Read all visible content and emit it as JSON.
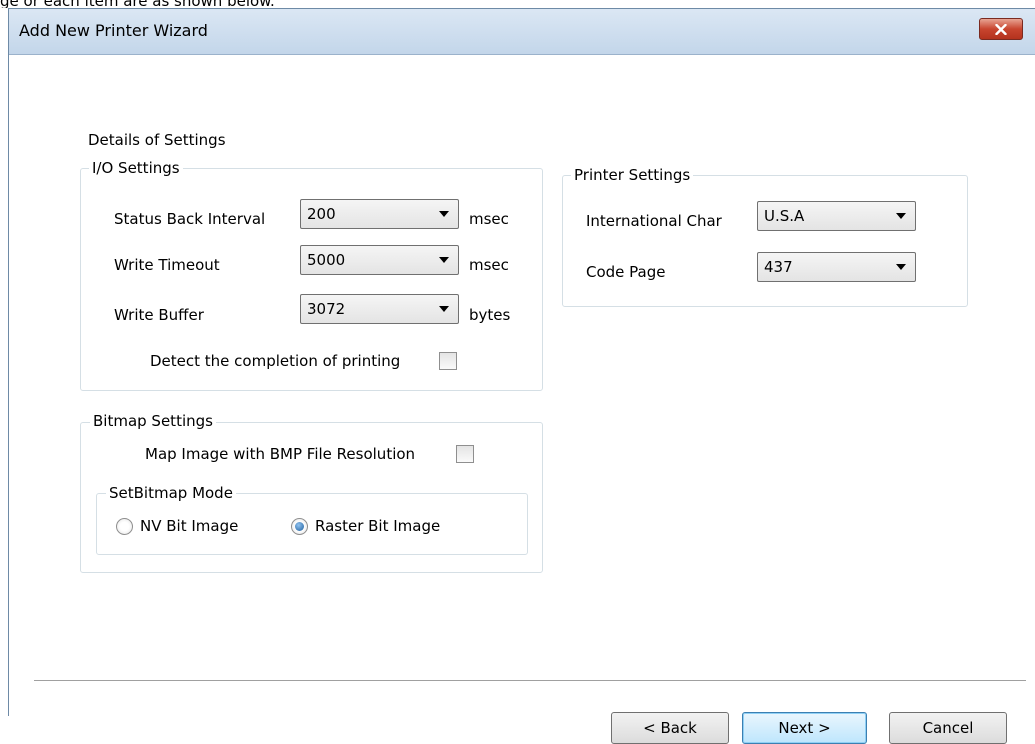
{
  "caption": "ge or each item are as shown below.",
  "window": {
    "title": "Add New Printer Wizard",
    "close_icon": "close-x-icon"
  },
  "details_heading": "Details of Settings",
  "io_settings": {
    "title": "I/O Settings",
    "status_back_interval": {
      "label": "Status Back Interval",
      "value": "200",
      "unit": "msec"
    },
    "write_timeout": {
      "label": "Write Timeout",
      "value": "5000",
      "unit": "msec"
    },
    "write_buffer": {
      "label": "Write Buffer",
      "value": "3072",
      "unit": "bytes"
    },
    "detect_completion": {
      "label": "Detect the completion of printing",
      "checked": false
    }
  },
  "printer_settings": {
    "title": "Printer Settings",
    "international_char": {
      "label": "International Char",
      "value": "U.S.A"
    },
    "code_page": {
      "label": "Code Page",
      "value": "437"
    }
  },
  "bitmap_settings": {
    "title": "Bitmap Settings",
    "map_image": {
      "label": "Map Image with BMP File Resolution",
      "checked": false
    },
    "setbitmap_mode": {
      "title": "SetBitmap Mode",
      "options": [
        {
          "label": "NV Bit Image",
          "selected": false
        },
        {
          "label": "Raster Bit Image",
          "selected": true
        }
      ]
    }
  },
  "buttons": {
    "back": "< Back",
    "next": "Next >",
    "cancel": "Cancel"
  },
  "colors": {
    "accent_blue": "#3c7fb1",
    "close_red": "#c8452f",
    "titlebar": "#c3d6ea"
  }
}
